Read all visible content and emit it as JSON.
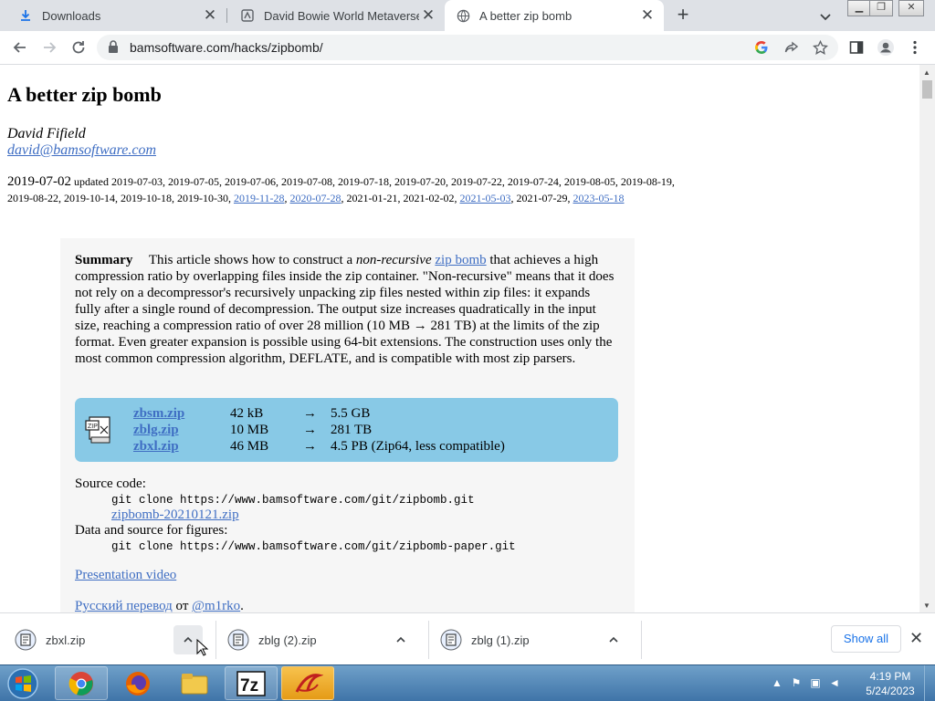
{
  "tabs": [
    {
      "title": "Downloads",
      "icon": "download-icon"
    },
    {
      "title": "David Bowie World Metaverse",
      "icon": "site-icon"
    },
    {
      "title": "A better zip bomb",
      "icon": "globe-icon",
      "active": true
    }
  ],
  "address_bar": {
    "url": "bamsoftware.com/hacks/zipbomb/"
  },
  "article": {
    "title": "A better zip bomb",
    "author": "David Fifield",
    "email": "david@bamsoftware.com",
    "first_date": "2019-07-02",
    "updated_prefix": "updated 2019-07-03, 2019-07-05, 2019-07-06, 2019-07-08, 2019-07-18, 2019-07-20, 2019-07-22, 2019-07-24, 2019-08-05, 2019-08-19, 2019-08-22, 2019-10-14, 2019-10-18, 2019-10-30, ",
    "date_link_1": "2019-11-28",
    "date_link_2": "2020-07-28",
    "dates_mid": ", 2021-01-21, 2021-02-02, ",
    "date_link_3": "2021-05-03",
    "dates_tail": ", 2021-07-29, ",
    "date_link_4": "2023-05-18",
    "summary_label": "Summary",
    "summary_p1": "This article shows how to construct a ",
    "summary_em": "non-recursive",
    "summary_link": "zip bomb",
    "summary_p2": " that achieves a high compression ratio by overlapping files inside the zip container. \"Non-recursive\" means that it does not rely on a decompressor's recursively unpacking zip files nested within zip files: it expands fully after a single round of decompression. The output size increases quadratically in the input size, reaching a compression ratio of over 28 million (10 MB → 281 TB) at the limits of the zip format. Even greater expansion is possible using 64-bit extensions. The construction uses only the most common compression algorithm, DEFLATE, and is compatible with most zip parsers.",
    "files": [
      {
        "name": "zbsm.zip",
        "size": "42 kB",
        "arrow": "→",
        "result": "5.5 GB"
      },
      {
        "name": "zblg.zip",
        "size": "10 MB",
        "arrow": "→",
        "result": "281 TB"
      },
      {
        "name": "zbxl.zip",
        "size": "46 MB",
        "arrow": "→",
        "result": "4.5 PB (Zip64, less compatible)"
      }
    ],
    "source_label": "Source code:",
    "source_cmd": "git clone https://www.bamsoftware.com/git/zipbomb.git",
    "source_zip": "zipbomb-20210121.zip",
    "figures_label": "Data and source for figures:",
    "figures_cmd": "git clone https://www.bamsoftware.com/git/zipbomb-paper.git",
    "video_link": "Presentation video",
    "translation_link": "Русский перевод",
    "translation_by": "от",
    "translation_author": "@m1rko",
    "translation_end": "."
  },
  "downloads": [
    {
      "name": "zbxl.zip"
    },
    {
      "name": "zblg (2).zip"
    },
    {
      "name": "zblg (1).zip"
    }
  ],
  "shelf": {
    "show_all": "Show all"
  },
  "taskbar": {
    "time": "4:19 PM",
    "date": "5/24/2023",
    "apps": [
      "chrome-icon",
      "firefox-icon",
      "file-explorer-icon",
      "7zip-icon",
      "app-icon"
    ],
    "sevenzip_label": "7z"
  }
}
